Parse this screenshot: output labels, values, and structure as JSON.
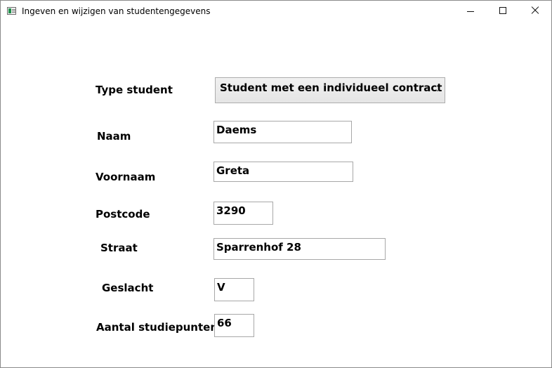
{
  "window": {
    "title": "Ingeven en wijzigen van studentengegevens",
    "icon": "app-window-icon",
    "controls": [
      "minimize-icon",
      "maximize-icon",
      "close-icon"
    ]
  },
  "form": {
    "type_student": {
      "label": "Type student",
      "value": "Student met een individueel contract",
      "dropdown_icon": "chevron-down-icon"
    },
    "naam": {
      "label": "Naam",
      "value": "Daems"
    },
    "voornaam": {
      "label": "Voornaam",
      "value": "Greta"
    },
    "postcode": {
      "label": "Postcode",
      "value": "3290"
    },
    "straat": {
      "label": "Straat",
      "value": "Sparrenhof 28"
    },
    "geslacht": {
      "label": "Geslacht",
      "value": "V"
    },
    "studiepunten": {
      "label": "Aantal studiepunten",
      "value": "66"
    }
  }
}
